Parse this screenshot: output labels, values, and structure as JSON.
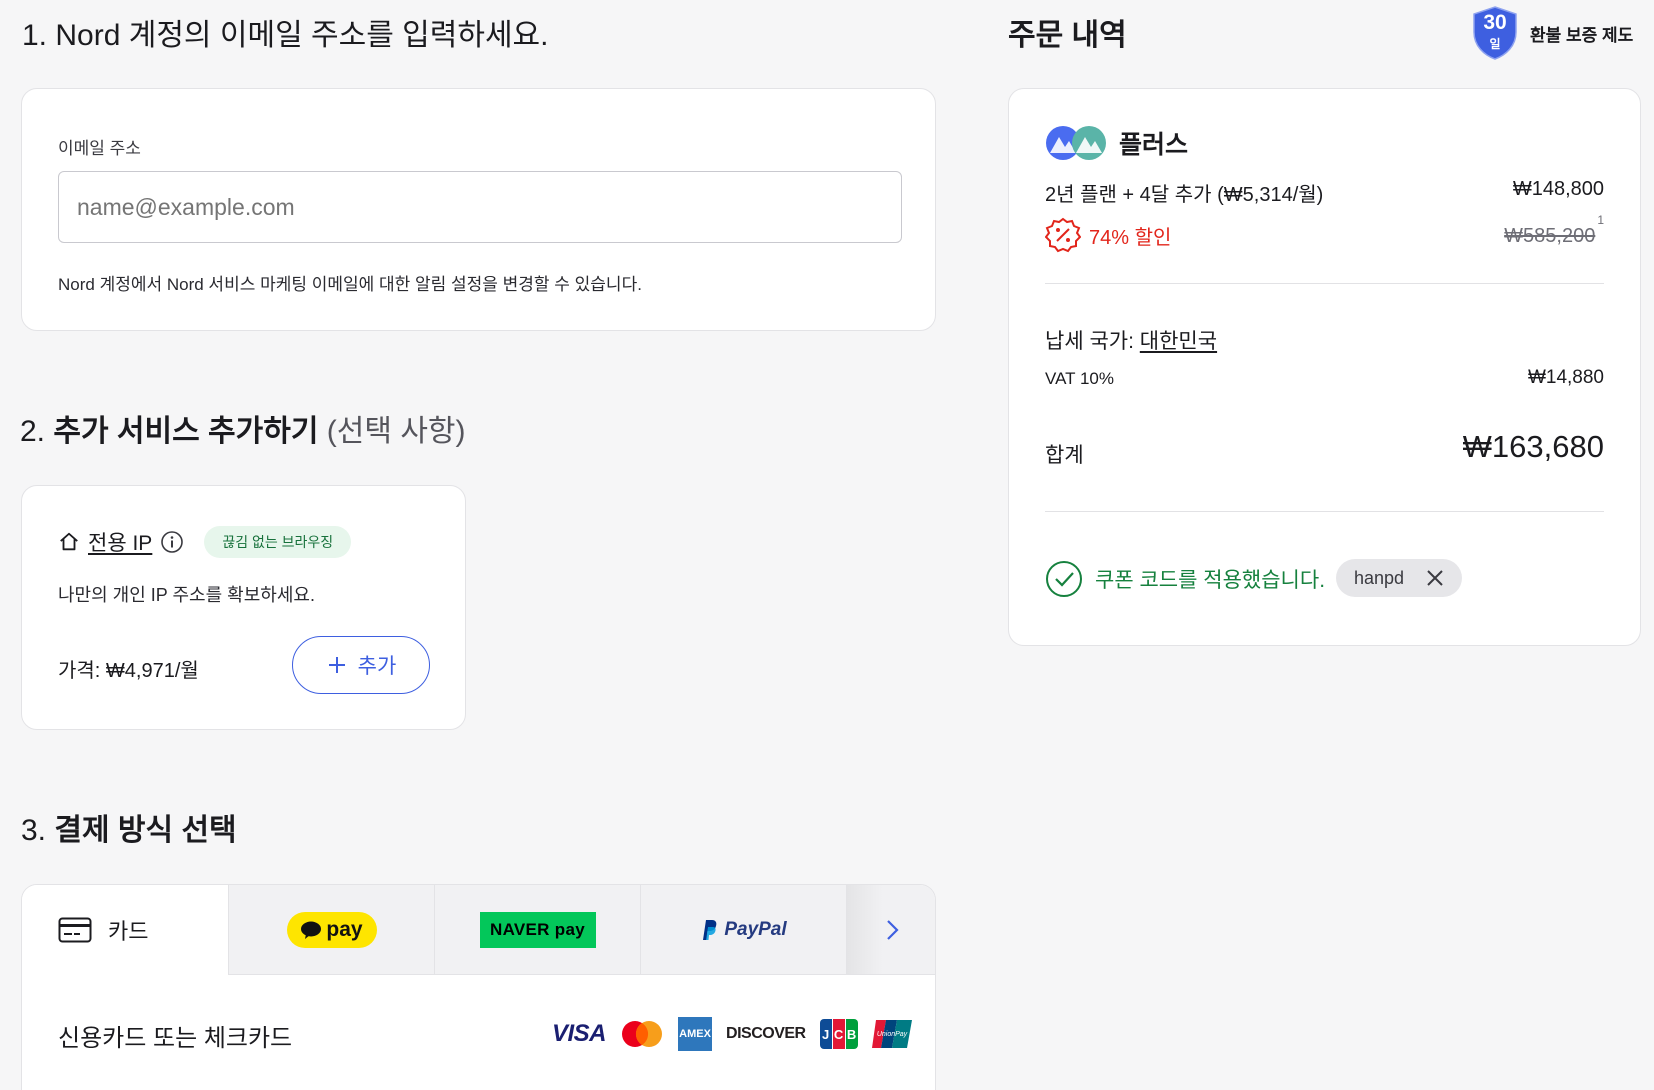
{
  "step1": {
    "number": "1.",
    "title": "Nord 계정의 이메일 주소를 입력하세요.",
    "email_label": "이메일 주소",
    "email_placeholder": "name@example.com",
    "email_value": "",
    "help_text": "Nord 계정에서 Nord 서비스 마케팅 이메일에 대한 알림 설정을 변경할 수 있습니다."
  },
  "step2": {
    "number": "2.",
    "title": "추가 서비스 추가하기",
    "optional": "(선택 사항)",
    "addon": {
      "name": "전용 IP",
      "badge": "끊김 없는 브라우징",
      "description": "나만의 개인 IP 주소를 확보하세요.",
      "price": "가격: ₩4,971/월",
      "add_label": "추가"
    }
  },
  "step3": {
    "number": "3.",
    "title": "결제 방식 선택",
    "tabs": [
      {
        "label": "카드",
        "icon": "credit-card-icon"
      },
      {
        "label": "pay",
        "icon": "kakao-pay-logo"
      },
      {
        "label": "NAVER pay",
        "icon": "naver-pay-logo"
      },
      {
        "label": "PayPal",
        "icon": "paypal-logo"
      }
    ],
    "card_section_title": "신용카드 또는 체크카드",
    "card_brands": [
      "VISA",
      "Mastercard",
      "AMEX",
      "DISCOVER",
      "JCB",
      "UnionPay"
    ]
  },
  "summary": {
    "title": "주문 내역",
    "guarantee_days": "30",
    "guarantee_unit": "일",
    "guarantee_label": "환불 보증 제도",
    "plan_name": "플러스",
    "plan_desc": "2년 플랜 + 4달 추가 (₩5,314/월)",
    "plan_price": "₩148,800",
    "discount_label": "74% 할인",
    "original_price": "₩585,200",
    "original_sup": "1",
    "tax_country_label": "납세 국가:",
    "tax_country": "대한민국",
    "vat_label": "VAT 10%",
    "vat_amount": "₩14,880",
    "total_label": "합계",
    "total_amount": "₩163,680",
    "coupon_applied": "쿠폰 코드를 적용했습니다.",
    "coupon_code": "hanpd"
  },
  "colors": {
    "accent_blue": "#3e5fe0",
    "green": "#16813e",
    "red": "#e2251b",
    "kakao_yellow": "#fee500",
    "naver_green": "#03c75a"
  }
}
